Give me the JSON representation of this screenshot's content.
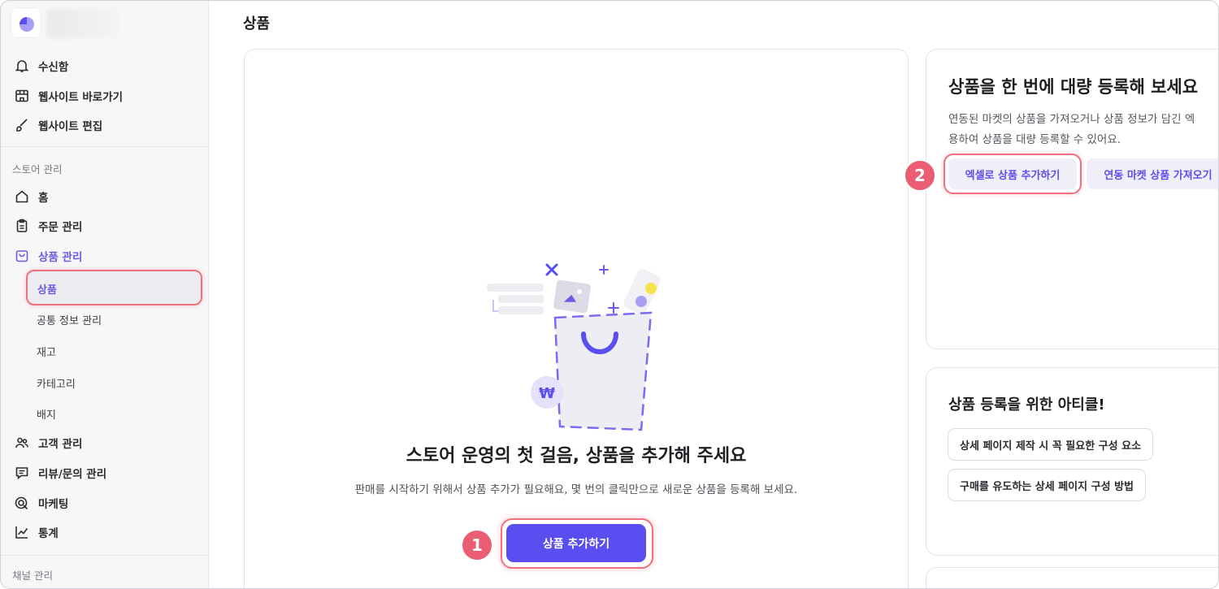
{
  "page": {
    "title": "상품"
  },
  "sidebar": {
    "top_items": [
      {
        "label": "수신함",
        "icon": "bell-icon"
      },
      {
        "label": "웹사이트 바로가기",
        "icon": "store-icon"
      },
      {
        "label": "웹사이트 편집",
        "icon": "brush-icon"
      }
    ],
    "store_section_label": "스토어 관리",
    "store_items": [
      {
        "label": "홈",
        "icon": "home-icon"
      },
      {
        "label": "주문 관리",
        "icon": "clipboard-icon"
      },
      {
        "label": "상품 관리",
        "icon": "bag-icon"
      }
    ],
    "product_sub_items": [
      "상품",
      "공통 정보 관리",
      "재고",
      "카테고리",
      "배지"
    ],
    "more_items": [
      {
        "label": "고객 관리",
        "icon": "users-icon"
      },
      {
        "label": "리뷰/문의 관리",
        "icon": "chat-icon"
      },
      {
        "label": "마케팅",
        "icon": "target-icon"
      },
      {
        "label": "통계",
        "icon": "chart-icon"
      }
    ],
    "channel_section_label": "채널 관리"
  },
  "empty_state": {
    "title": "스토어 운영의 첫 걸음, 상품을 추가해 주세요",
    "description": "판매를 시작하기 위해서 상품 추가가 필요해요, 몇 번의 클릭만으로 새로운 상품을 등록해 보세요.",
    "button_label": "상품 추가하기",
    "step_badge": "1"
  },
  "bulk_card": {
    "title": "상품을 한 번에 대량 등록해 보세요",
    "description_line1": "연동된 마켓의 상품을 가져오거나 상품 정보가 담긴 엑",
    "description_line2": "용하여 상품을 대량 등록할 수 있어요.",
    "excel_button": "엑셀로 상품 추가하기",
    "market_button": "연동 마켓 상품 가져오기",
    "step_badge": "2"
  },
  "article_card": {
    "title": "상품 등록을 위한 아티클!",
    "links": [
      "상세 페이지 제작 시 꼭 필요한 구성 요소",
      "구매를 유도하는 상세 페이지 구성 방법"
    ]
  },
  "colors": {
    "accent": "#5b4ef0",
    "highlight": "#f07080",
    "badge": "#ea5d72"
  }
}
